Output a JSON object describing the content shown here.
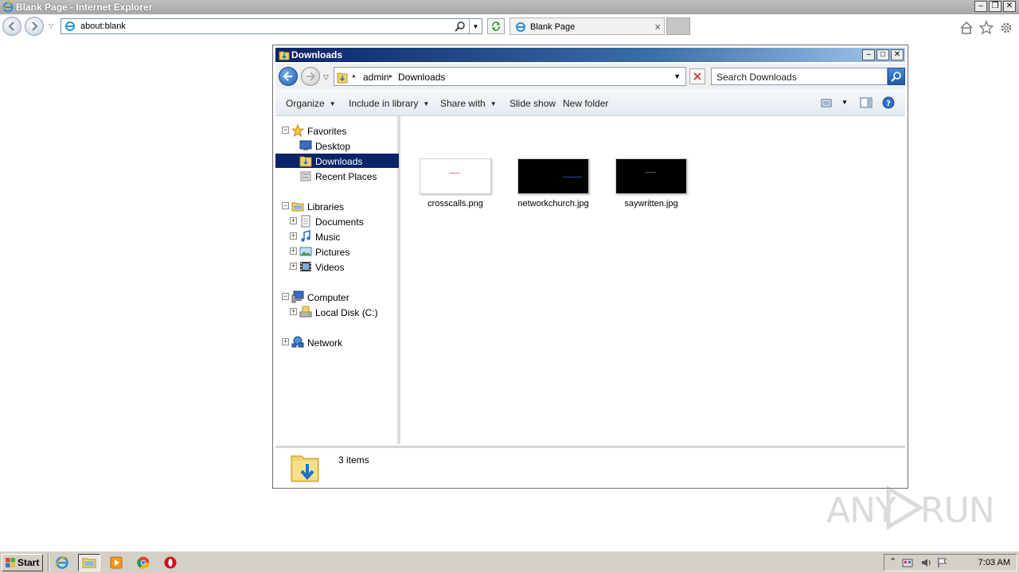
{
  "browser": {
    "window_title": "Blank Page - Internet Explorer",
    "address": "about:blank",
    "tab_title": "Blank Page"
  },
  "explorer": {
    "title": "Downloads",
    "breadcrumb": [
      "admin",
      "Downloads"
    ],
    "search_placeholder": "Search Downloads",
    "toolbar": {
      "organize": "Organize",
      "include_in_library": "Include in library",
      "share_with": "Share with",
      "slide_show": "Slide show",
      "new_folder": "New folder"
    },
    "nav": {
      "favorites": "Favorites",
      "desktop": "Desktop",
      "downloads": "Downloads",
      "recent_places": "Recent Places",
      "libraries": "Libraries",
      "documents": "Documents",
      "music": "Music",
      "pictures": "Pictures",
      "videos": "Videos",
      "computer": "Computer",
      "local_disk": "Local Disk (C:)",
      "network": "Network"
    },
    "files": [
      {
        "name": "crosscalls.png",
        "thumb_color": "#ffffff"
      },
      {
        "name": "networkchurch.jpg",
        "thumb_color": "#000000"
      },
      {
        "name": "saywritten.jpg",
        "thumb_color": "#000000"
      }
    ],
    "status": "3 items"
  },
  "watermark": {
    "left": "ANY",
    "right": "RUN"
  },
  "taskbar": {
    "start_label": "Start",
    "clock": "7:03 AM"
  },
  "colors": {
    "selection": "#0a246a",
    "title_gradient_start": "#0a246a",
    "title_gradient_end": "#a6caf0"
  }
}
